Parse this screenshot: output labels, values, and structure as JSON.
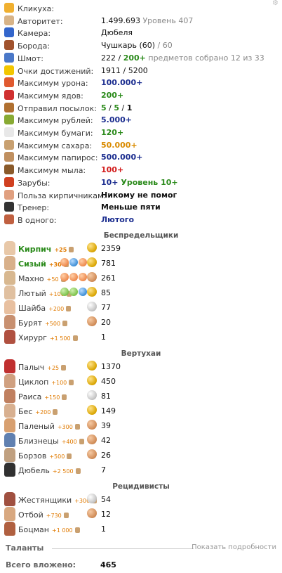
{
  "stats": [
    {
      "label": "Кликуха:",
      "icon": "smiley-icon",
      "color": "#f0b030",
      "parts": []
    },
    {
      "label": "Авторитет:",
      "icon": "fist-icon",
      "color": "#d8b488",
      "parts": [
        {
          "t": "1.499.693",
          "c": ""
        },
        {
          "t": " Уровень 407",
          "c": "sub"
        }
      ]
    },
    {
      "label": "Камера:",
      "icon": "house-icon",
      "color": "#3366cc",
      "parts": [
        {
          "t": "Дюбеля",
          "c": ""
        }
      ]
    },
    {
      "label": "Борода:",
      "icon": "beard-icon",
      "color": "#a0522d",
      "parts": [
        {
          "t": "Чушкарь (60)",
          "c": ""
        },
        {
          "t": " / 60",
          "c": "sub"
        }
      ]
    },
    {
      "label": "Шмот:",
      "icon": "shirt-icon",
      "color": "#4a78c8",
      "parts": [
        {
          "t": "222",
          "c": ""
        },
        {
          "t": " / ",
          "c": ""
        },
        {
          "t": "200+",
          "c": "green"
        },
        {
          "t": "   предметов собрано 12 из 33",
          "c": "sub"
        }
      ]
    },
    {
      "label": "Очки достижений:",
      "icon": "star-icon",
      "color": "#f2c600",
      "parts": [
        {
          "t": "1911 / 5200",
          "c": ""
        }
      ]
    },
    {
      "label": "Максимум урона:",
      "icon": "damage-icon",
      "color": "#e05a30",
      "parts": [
        {
          "t": "100.000+",
          "c": "blue"
        }
      ]
    },
    {
      "label": "Максимум ядов:",
      "icon": "poison-icon",
      "color": "#d03030",
      "parts": [
        {
          "t": "200+",
          "c": "green"
        }
      ]
    },
    {
      "label": "Отправил посылок:",
      "icon": "parcel-icon",
      "color": "#b07030",
      "parts": [
        {
          "t": "5",
          "c": "green"
        },
        {
          "t": " / ",
          "c": ""
        },
        {
          "t": "5",
          "c": "green"
        },
        {
          "t": " / ",
          "c": ""
        },
        {
          "t": "1",
          "c": "black"
        }
      ]
    },
    {
      "label": "Максимум рублей:",
      "icon": "ruble-icon",
      "color": "#88aa33",
      "parts": [
        {
          "t": "5.000+",
          "c": "blue"
        }
      ]
    },
    {
      "label": "Максимум бумаги:",
      "icon": "paper-icon",
      "color": "#e8e8e8",
      "parts": [
        {
          "t": "120+",
          "c": "green"
        }
      ]
    },
    {
      "label": "Максимум сахара:",
      "icon": "sugar-icon",
      "color": "#c8a070",
      "parts": [
        {
          "t": "50.000+",
          "c": "orange"
        }
      ]
    },
    {
      "label": "Максимум папирос:",
      "icon": "cigarette-icon",
      "color": "#c09060",
      "parts": [
        {
          "t": "500.000+",
          "c": "blue"
        }
      ]
    },
    {
      "label": "Максимум мыла:",
      "icon": "soap-icon",
      "color": "#8a5a2a",
      "parts": [
        {
          "t": "100+",
          "c": "red"
        }
      ]
    },
    {
      "label": "Зарубы:",
      "icon": "crossed-swords-icon",
      "color": "#d04020",
      "parts": [
        {
          "t": "10+",
          "c": "blue"
        },
        {
          "t": "  Уровень 10+",
          "c": "green"
        }
      ]
    },
    {
      "label": "Польза кирпичникам:",
      "icon": "face-icon",
      "color": "#e0a080",
      "parts": [
        {
          "t": "Никому не помог",
          "c": "black"
        }
      ]
    },
    {
      "label": "Тренер:",
      "icon": "kettlebell-icon",
      "color": "#333333",
      "parts": [
        {
          "t": "Меньше пяти",
          "c": "black"
        }
      ]
    },
    {
      "label": "В одного:",
      "icon": "fist-icon",
      "color": "#c06040",
      "parts": [
        {
          "t": "Лютого",
          "c": "blue"
        }
      ]
    }
  ],
  "groups": [
    {
      "title": "Беспредельщики",
      "members": [
        {
          "name": "Кирпич",
          "bonus": "+25",
          "rank": "gold",
          "score": "2359",
          "hl": true,
          "balls": [],
          "skin": "#e8c8a8"
        },
        {
          "name": "Сизый",
          "bonus": "+30",
          "rank": "gold",
          "score": "781",
          "hl": true,
          "balls": [
            "b-orange",
            "b-blue",
            "b-orange",
            "b-orange"
          ],
          "skin": "#d8b08a"
        },
        {
          "name": "Махно",
          "bonus": "+50",
          "rank": "bronze",
          "score": "261",
          "hl": false,
          "balls": [
            "b-orange",
            "b-orange",
            "b-orange"
          ],
          "skin": "#d8b890"
        },
        {
          "name": "Лютый",
          "bonus": "+100",
          "rank": "gold",
          "score": "85",
          "hl": false,
          "balls": [
            "b-green",
            "b-green",
            "b-blue"
          ],
          "skin": "#e0c0a0"
        },
        {
          "name": "Шайба",
          "bonus": "+200",
          "rank": "silver",
          "score": "77",
          "hl": false,
          "balls": [],
          "skin": "#e8c0a0"
        },
        {
          "name": "Бурят",
          "bonus": "+500",
          "rank": "bronze",
          "score": "20",
          "hl": false,
          "balls": [],
          "skin": "#c89070"
        },
        {
          "name": "Хирург",
          "bonus": "+1 500",
          "rank": "",
          "score": "1",
          "hl": false,
          "balls": [],
          "skin": "#b05040"
        }
      ]
    },
    {
      "title": "Вертухаи",
      "members": [
        {
          "name": "Палыч",
          "bonus": "+25",
          "rank": "gold",
          "score": "1370",
          "hl": false,
          "balls": [],
          "skin": "#c03030"
        },
        {
          "name": "Циклоп",
          "bonus": "+100",
          "rank": "gold",
          "score": "450",
          "hl": false,
          "balls": [],
          "skin": "#d0a080"
        },
        {
          "name": "Раиса",
          "bonus": "+150",
          "rank": "silver",
          "score": "81",
          "hl": false,
          "balls": [],
          "skin": "#c08060"
        },
        {
          "name": "Бес",
          "bonus": "+200",
          "rank": "gold",
          "score": "149",
          "hl": false,
          "balls": [],
          "skin": "#d8b090"
        },
        {
          "name": "Паленый",
          "bonus": "+300",
          "rank": "bronze",
          "score": "39",
          "hl": false,
          "balls": [],
          "skin": "#d8a070"
        },
        {
          "name": "Близнецы",
          "bonus": "+400",
          "rank": "bronze",
          "score": "42",
          "hl": false,
          "balls": [],
          "skin": "#6080b0"
        },
        {
          "name": "Борзов",
          "bonus": "+500",
          "rank": "bronze",
          "score": "26",
          "hl": false,
          "balls": [],
          "skin": "#c0a080"
        },
        {
          "name": "Дюбель",
          "bonus": "+2 500",
          "rank": "",
          "score": "7",
          "hl": false,
          "balls": [],
          "skin": "#303030"
        }
      ]
    },
    {
      "title": "Рецидивисты",
      "members": [
        {
          "name": "Жестянщики",
          "bonus": "+300",
          "rank": "silver",
          "score": "54",
          "hl": false,
          "balls": [],
          "skin": "#a05040"
        },
        {
          "name": "Отбой",
          "bonus": "+730",
          "rank": "bronze",
          "score": "12",
          "hl": false,
          "balls": [],
          "skin": "#d8a880"
        },
        {
          "name": "Боцман",
          "bonus": "+1 000",
          "rank": "",
          "score": "1",
          "hl": false,
          "balls": [],
          "skin": "#b06040"
        }
      ]
    }
  ],
  "talents": {
    "title": "Таланты",
    "more": "Показать подробности"
  },
  "total": {
    "label": "Всего вложено:",
    "value": "465"
  }
}
